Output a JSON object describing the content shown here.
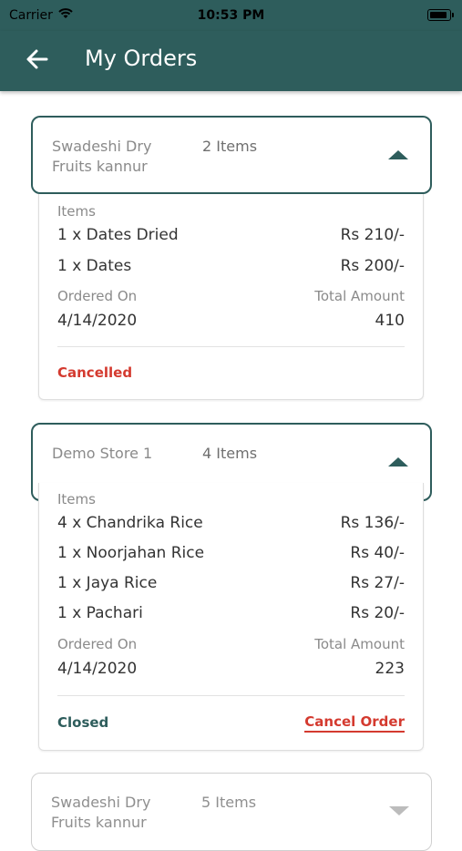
{
  "statusbar": {
    "carrier": "Carrier",
    "time": "10:53 PM"
  },
  "header": {
    "title": "My Orders"
  },
  "orders": [
    {
      "store": "Swadeshi Dry Fruits kannur",
      "item_count": "2 Items",
      "items_label": "Items",
      "items": [
        {
          "name": "1 x Dates Dried",
          "price": "Rs 210/-"
        },
        {
          "name": "1 x Dates",
          "price": "Rs 200/-"
        }
      ],
      "ordered_on_label": "Ordered On",
      "ordered_on": "4/14/2020",
      "total_label": "Total Amount",
      "total": "410",
      "status": "Cancelled",
      "status_color": "#d43a2f"
    },
    {
      "store": "Demo Store 1",
      "item_count": "4 Items",
      "items_label": "Items",
      "items": [
        {
          "name": "4 x Chandrika Rice",
          "price": "Rs 136/-"
        },
        {
          "name": "1 x Noorjahan Rice",
          "price": "Rs 40/-"
        },
        {
          "name": "1 x Jaya Rice",
          "price": "Rs 27/-"
        },
        {
          "name": "1 x Pachari",
          "price": "Rs 20/-"
        }
      ],
      "ordered_on_label": "Ordered On",
      "ordered_on": "4/14/2020",
      "total_label": "Total Amount",
      "total": "223",
      "status": "Closed",
      "status_color": "#2e5d5c",
      "action": "Cancel Order"
    },
    {
      "store": "Swadeshi Dry Fruits kannur",
      "item_count": "5 Items"
    }
  ],
  "colors": {
    "primary": "#2e5d5c",
    "danger": "#d43a2f"
  }
}
